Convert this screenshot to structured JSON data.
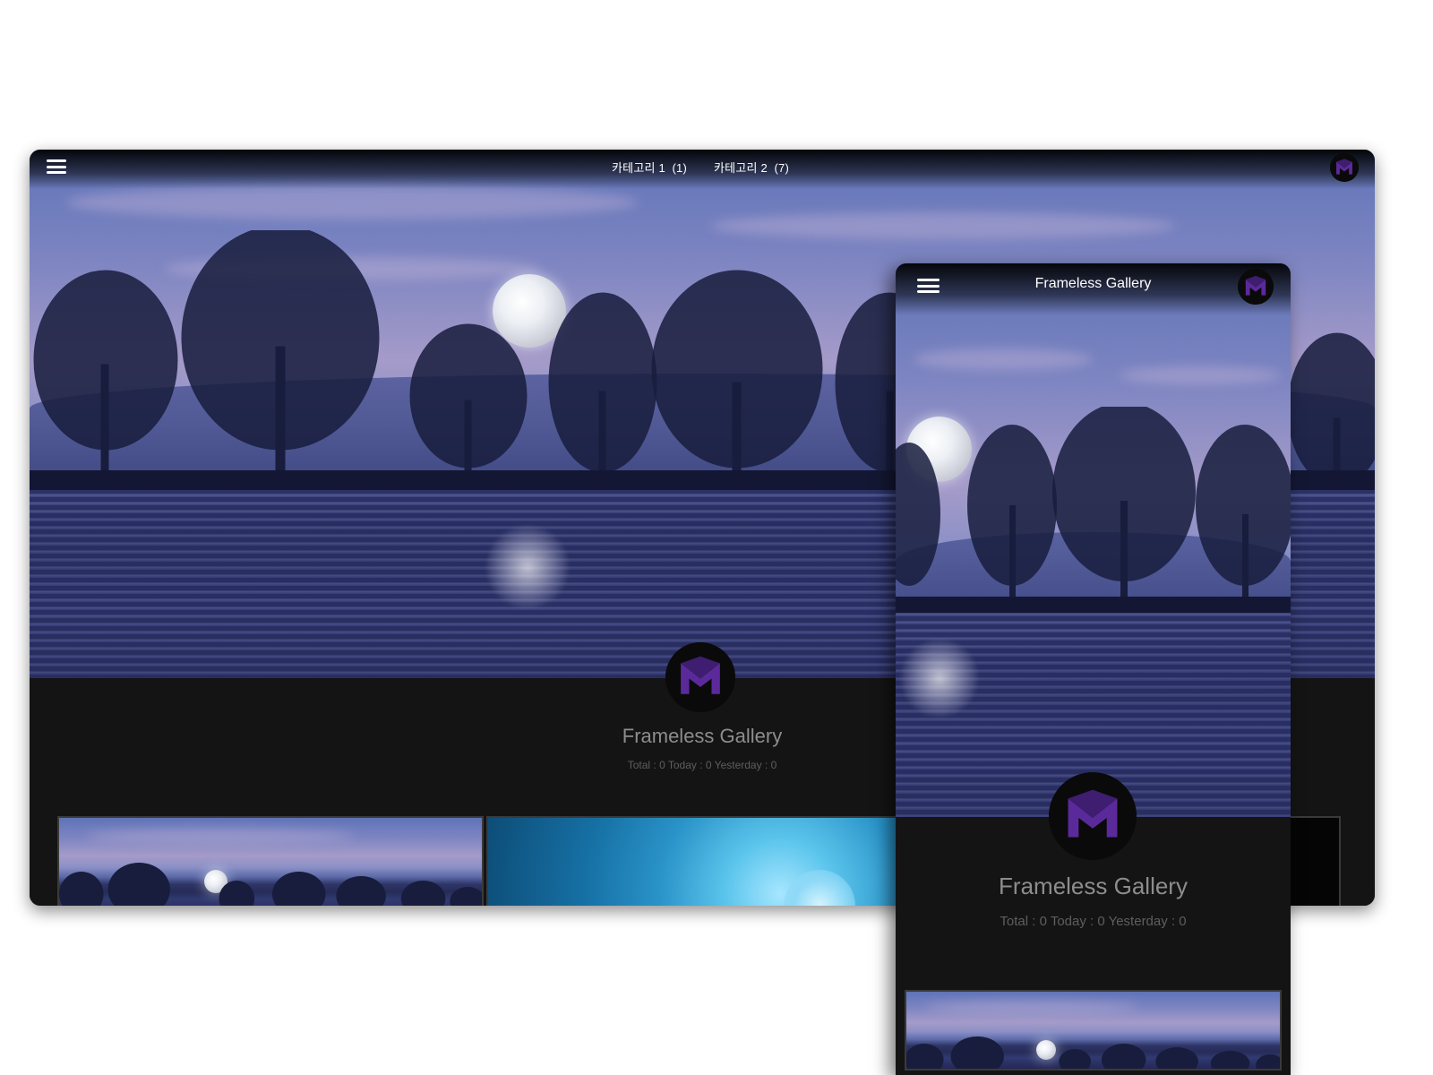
{
  "desktop": {
    "nav": {
      "categories": [
        {
          "label": "카테고리 1",
          "count": "(1)"
        },
        {
          "label": "카테고리 2",
          "count": "(7)"
        }
      ]
    },
    "site_title": "Frameless Gallery",
    "stats": "Total : 0 Today : 0 Yesterday : 0"
  },
  "mobile": {
    "header_title": "Frameless Gallery",
    "site_title": "Frameless Gallery",
    "stats": "Total : 0 Today : 0 Yesterday : 0"
  },
  "icons": {
    "menu": "hamburger-icon",
    "logo": "m-logo-icon"
  },
  "colors": {
    "logo_purple": "#5b2a9a",
    "background_dark": "#141414",
    "title_gray": "#8d8d8d",
    "stats_gray": "#5e5e5e"
  }
}
